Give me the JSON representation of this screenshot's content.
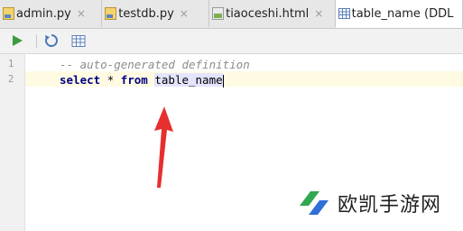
{
  "tabs": [
    {
      "label": "admin.py",
      "close": "×",
      "icon": "python-file-icon"
    },
    {
      "label": "testdb.py",
      "close": "×",
      "icon": "python-file-icon"
    },
    {
      "label": "tiaoceshi.html",
      "close": "×",
      "icon": "html-file-icon"
    },
    {
      "label": "table_name (DDL",
      "close": "",
      "icon": "table-icon",
      "active": true
    }
  ],
  "toolbar": {
    "run": "run-icon",
    "refresh": "refresh-icon",
    "table": "table-view-icon"
  },
  "editor": {
    "line_numbers": [
      "1",
      "2"
    ],
    "line1_comment": "-- auto-generated definition",
    "line2_kw1": "select",
    "line2_star": " * ",
    "line2_kw2": "from",
    "line2_space": " ",
    "line2_ident": "table_name"
  },
  "watermark": {
    "text": "欧凯手游网"
  },
  "colors": {
    "run_green": "#3c9b3c",
    "arrow_red": "#e5302f",
    "watermark_green": "#2fa84f",
    "watermark_blue": "#2f6fd6"
  }
}
